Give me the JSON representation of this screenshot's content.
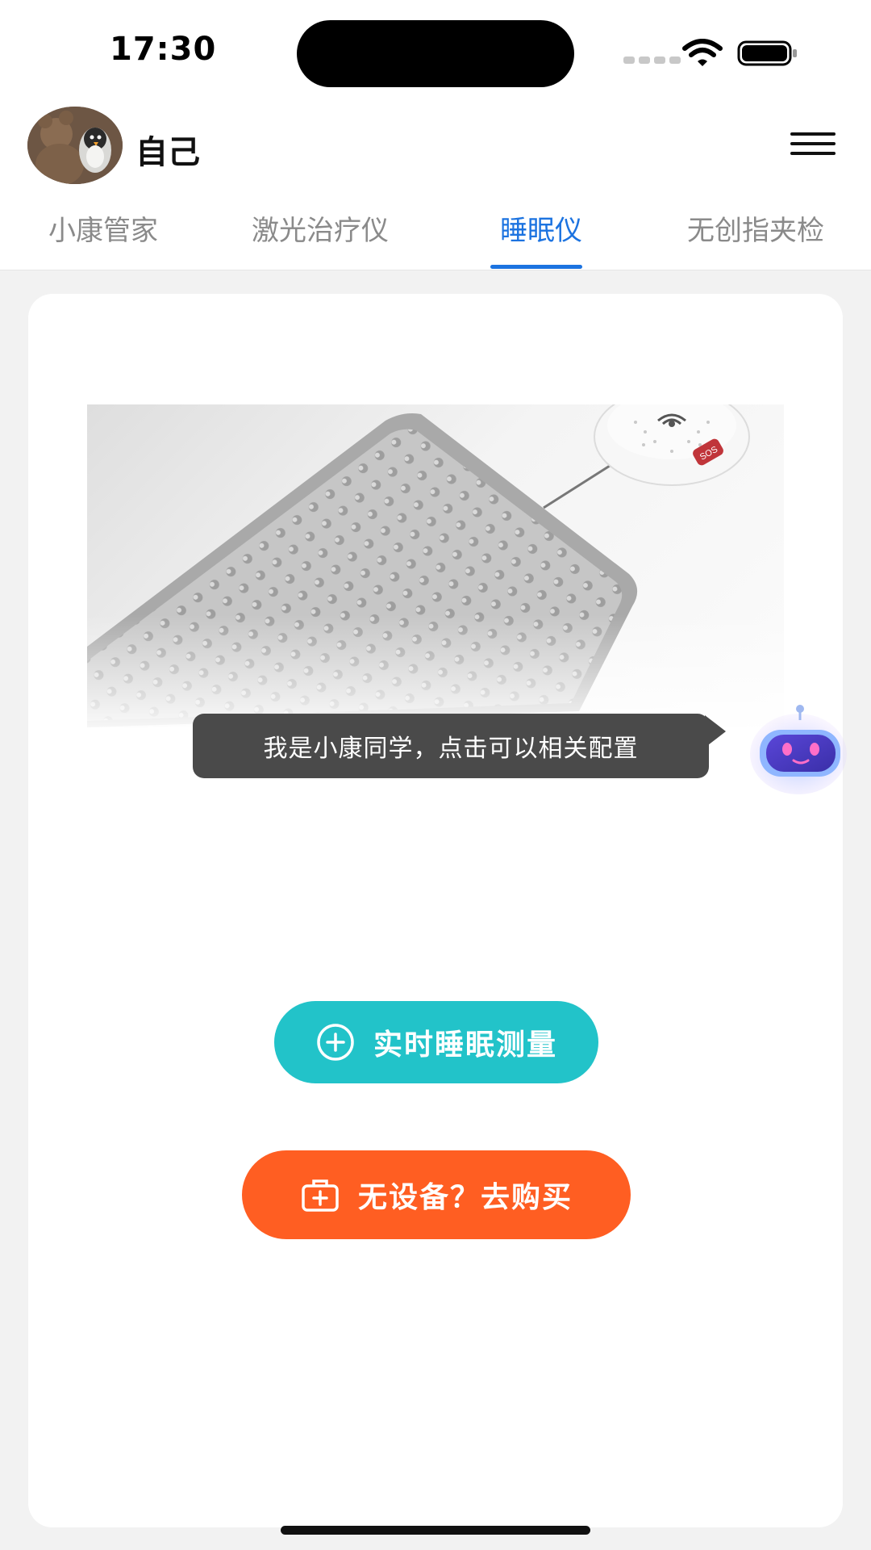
{
  "status_bar": {
    "time": "17:30"
  },
  "header": {
    "username": "自己",
    "menu_icon": "hamburger-menu-icon"
  },
  "tabs": [
    {
      "label": "小康管家",
      "active": false
    },
    {
      "label": "激光治疗仪",
      "active": false
    },
    {
      "label": "睡眠仪",
      "active": true
    },
    {
      "label": "无创指夹检",
      "active": false
    }
  ],
  "assistant": {
    "tooltip": "我是小康同学，点击可以相关配置",
    "icon": "robot-assistant-icon"
  },
  "actions": {
    "measure_label": "实时睡眠测量",
    "measure_icon": "plus-circle-icon",
    "buy_label": "无设备？去购买",
    "buy_icon": "medical-kit-icon"
  },
  "product_badge": "SOS",
  "colors": {
    "accent": "#1c73e0",
    "measure_button": "#22c3c9",
    "buy_button": "#ff5e22",
    "tooltip_bg": "#4a4a4a"
  }
}
